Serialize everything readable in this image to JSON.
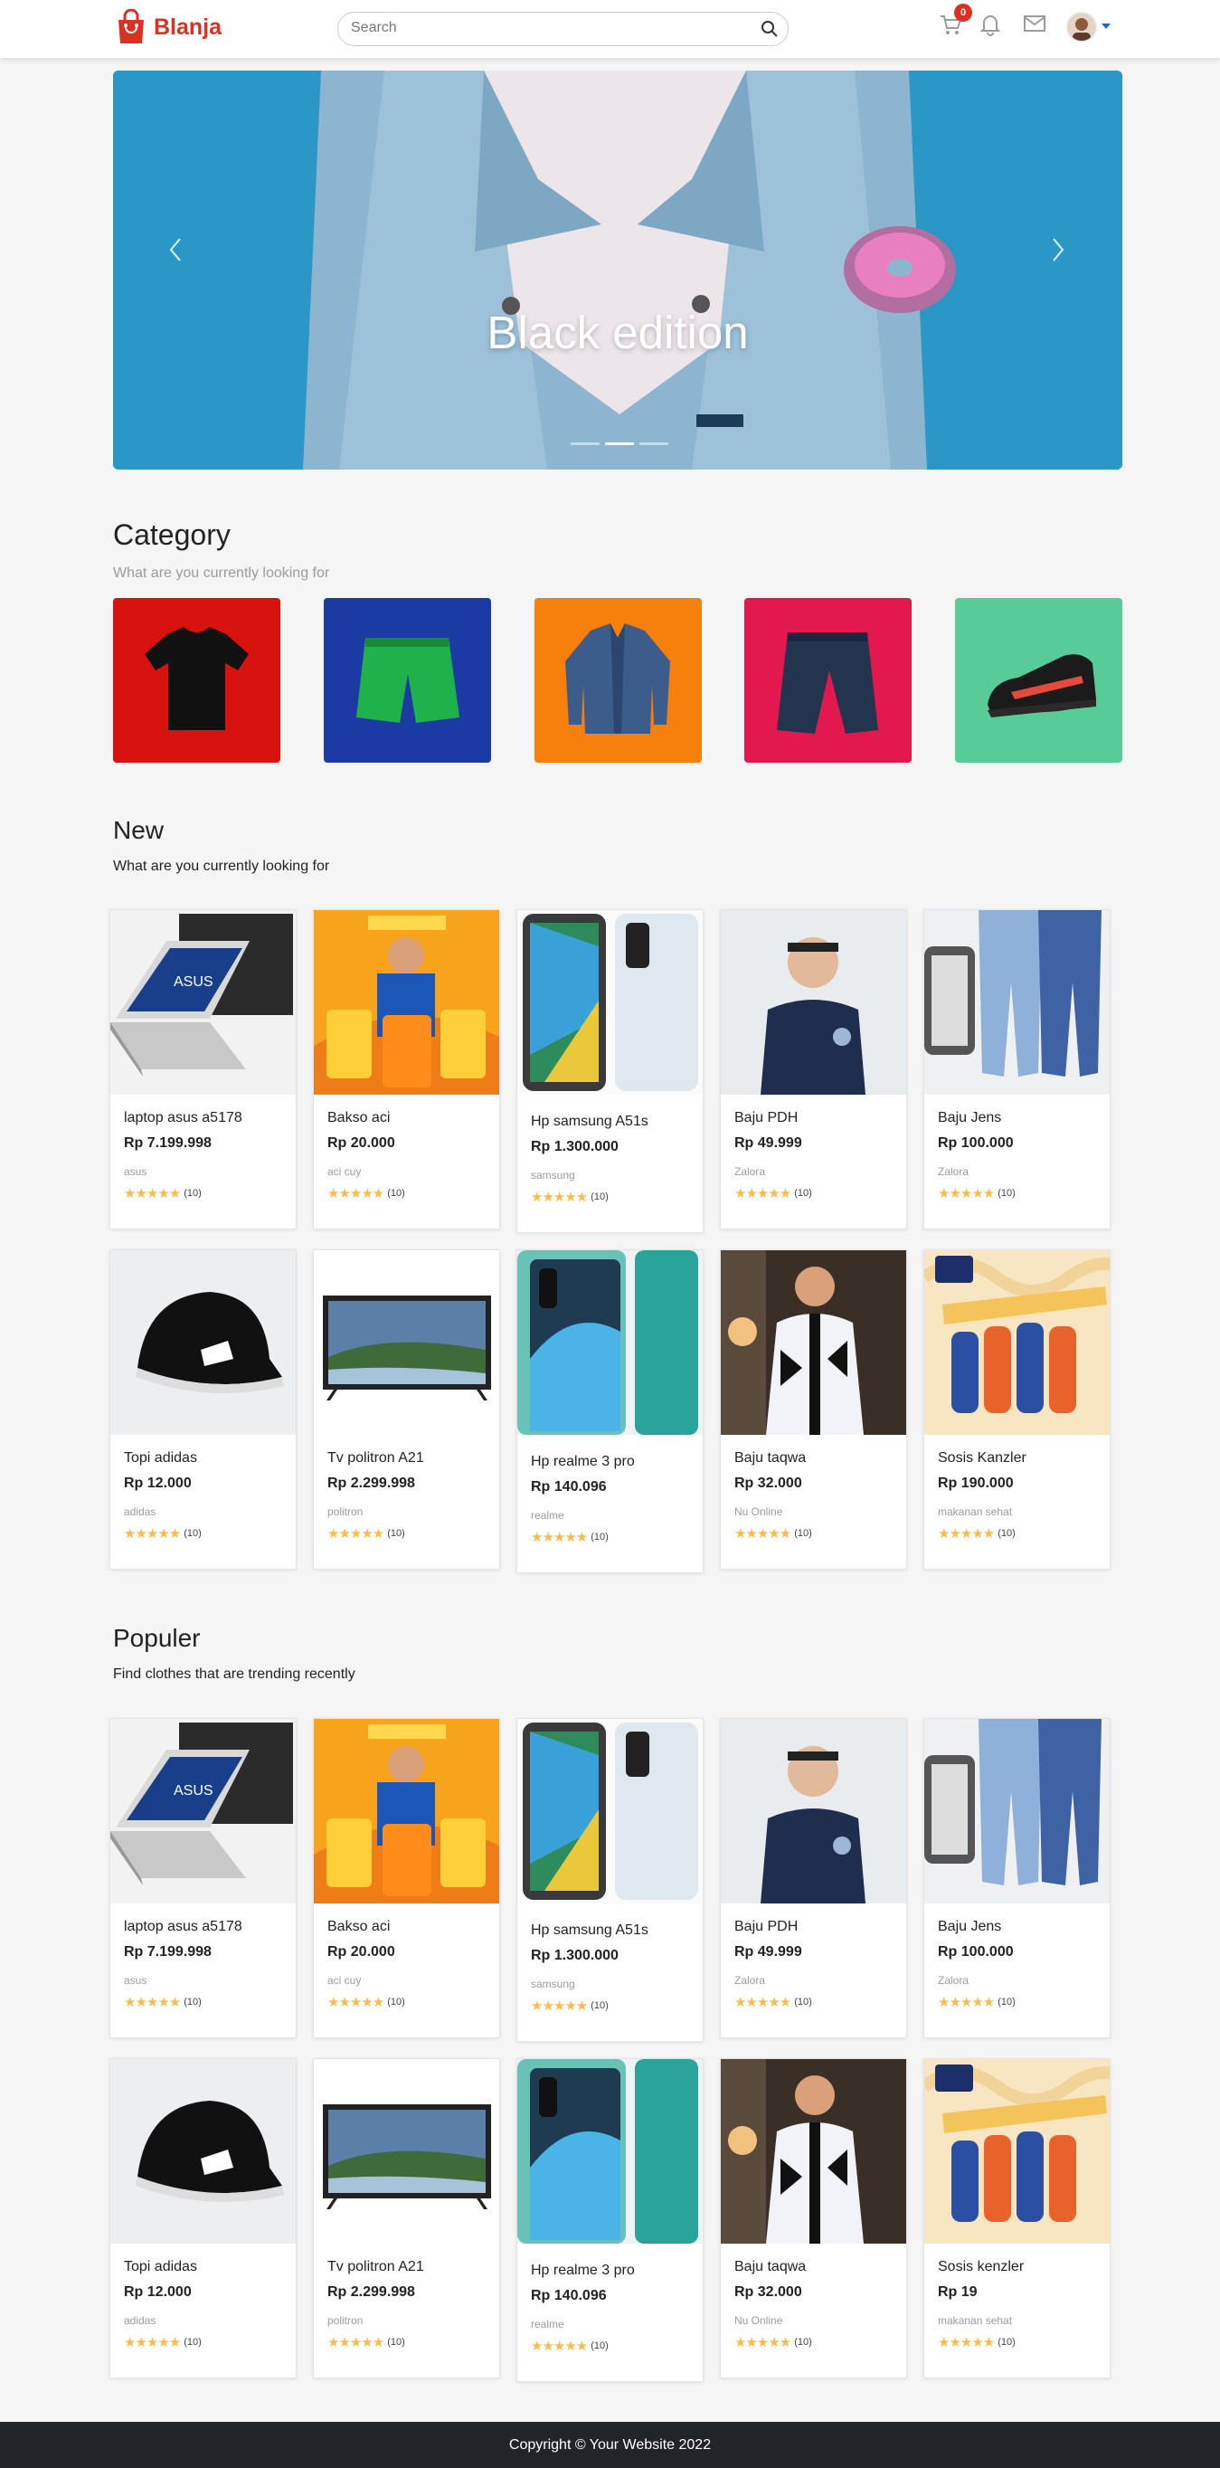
{
  "brand": {
    "name": "Blanja",
    "color": "#db3022"
  },
  "search": {
    "placeholder": "Search"
  },
  "header": {
    "cart_count": "0"
  },
  "hero": {
    "title": "Black edition",
    "slide_count": 3,
    "active_slide": 2
  },
  "category": {
    "title": "Category",
    "subtitle": "What are you currently looking for",
    "items": [
      {
        "icon": "tshirt-icon",
        "bg": "#d8120f"
      },
      {
        "icon": "shorts-icon",
        "bg": "#1b3aa4"
      },
      {
        "icon": "jacket-icon",
        "bg": "#f77f0c"
      },
      {
        "icon": "pants-icon",
        "bg": "#e2184e"
      },
      {
        "icon": "shoe-icon",
        "bg": "#57cc99"
      }
    ]
  },
  "new_section": {
    "title": "New",
    "subtitle": "What are you currently looking for",
    "products": [
      {
        "name": "laptop asus a5178",
        "price": "Rp 7.199.998",
        "store": "asus",
        "reviews": "(10)",
        "rating": 5
      },
      {
        "name": "Bakso aci",
        "price": "Rp 20.000",
        "store": "aci cuy",
        "reviews": "(10)",
        "rating": 5
      },
      {
        "name": "Hp samsung A51s",
        "price": "Rp 1.300.000",
        "store": "samsung",
        "reviews": "(10)",
        "rating": 5
      },
      {
        "name": "Baju PDH",
        "price": "Rp 49.999",
        "store": "Zalora",
        "reviews": "(10)",
        "rating": 5
      },
      {
        "name": "Baju Jens",
        "price": "Rp 100.000",
        "store": "Zalora",
        "reviews": "(10)",
        "rating": 5
      },
      {
        "name": "Topi adidas",
        "price": "Rp 12.000",
        "store": "adidas",
        "reviews": "(10)",
        "rating": 5
      },
      {
        "name": "Tv politron A21",
        "price": "Rp 2.299.998",
        "store": "politron",
        "reviews": "(10)",
        "rating": 5
      },
      {
        "name": "Hp realme 3 pro",
        "price": "Rp 140.096",
        "store": "realme",
        "reviews": "(10)",
        "rating": 5
      },
      {
        "name": "Baju taqwa",
        "price": "Rp 32.000",
        "store": "Nu Online",
        "reviews": "(10)",
        "rating": 5
      },
      {
        "name": "Sosis Kanzler",
        "price": "Rp 190.000",
        "store": "makanan sehat",
        "reviews": "(10)",
        "rating": 5
      }
    ]
  },
  "popular_section": {
    "title": "Populer",
    "subtitle": "Find clothes that are trending recently",
    "products": [
      {
        "name": "laptop asus a5178",
        "price": "Rp 7.199.998",
        "store": "asus",
        "reviews": "(10)",
        "rating": 5
      },
      {
        "name": "Bakso aci",
        "price": "Rp 20.000",
        "store": "aci cuy",
        "reviews": "(10)",
        "rating": 5
      },
      {
        "name": "Hp samsung A51s",
        "price": "Rp 1.300.000",
        "store": "samsung",
        "reviews": "(10)",
        "rating": 5
      },
      {
        "name": "Baju PDH",
        "price": "Rp 49.999",
        "store": "Zalora",
        "reviews": "(10)",
        "rating": 5
      },
      {
        "name": "Baju Jens",
        "price": "Rp 100.000",
        "store": "Zalora",
        "reviews": "(10)",
        "rating": 5
      },
      {
        "name": "Topi adidas",
        "price": "Rp 12.000",
        "store": "adidas",
        "reviews": "(10)",
        "rating": 5
      },
      {
        "name": "Tv politron A21",
        "price": "Rp 2.299.998",
        "store": "politron",
        "reviews": "(10)",
        "rating": 5
      },
      {
        "name": "Hp realme 3 pro",
        "price": "Rp 140.096",
        "store": "realme",
        "reviews": "(10)",
        "rating": 5
      },
      {
        "name": "Baju taqwa",
        "price": "Rp 32.000",
        "store": "Nu Online",
        "reviews": "(10)",
        "rating": 5
      },
      {
        "name": "Sosis kenzler",
        "price": "Rp 19",
        "store": "makanan sehat",
        "reviews": "(10)",
        "rating": 5
      }
    ]
  },
  "footer": {
    "text": "Copyright © Your Website 2022"
  }
}
